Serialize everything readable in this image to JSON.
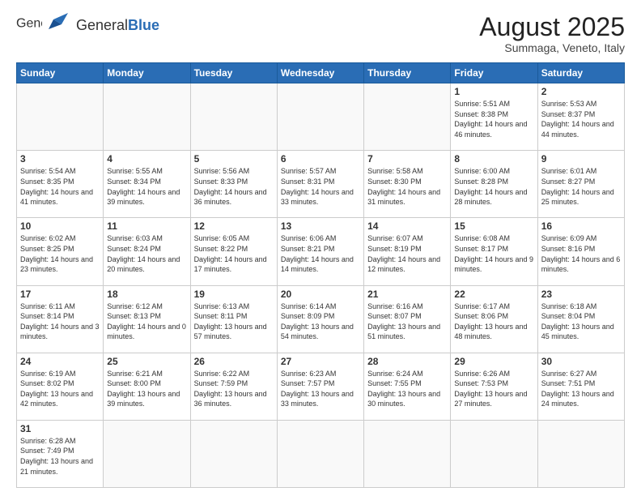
{
  "header": {
    "logo_general": "General",
    "logo_blue": "Blue",
    "month_title": "August 2025",
    "subtitle": "Summaga, Veneto, Italy"
  },
  "days_of_week": [
    "Sunday",
    "Monday",
    "Tuesday",
    "Wednesday",
    "Thursday",
    "Friday",
    "Saturday"
  ],
  "weeks": [
    [
      {
        "num": "",
        "info": ""
      },
      {
        "num": "",
        "info": ""
      },
      {
        "num": "",
        "info": ""
      },
      {
        "num": "",
        "info": ""
      },
      {
        "num": "",
        "info": ""
      },
      {
        "num": "1",
        "info": "Sunrise: 5:51 AM\nSunset: 8:38 PM\nDaylight: 14 hours and 46 minutes."
      },
      {
        "num": "2",
        "info": "Sunrise: 5:53 AM\nSunset: 8:37 PM\nDaylight: 14 hours and 44 minutes."
      }
    ],
    [
      {
        "num": "3",
        "info": "Sunrise: 5:54 AM\nSunset: 8:35 PM\nDaylight: 14 hours and 41 minutes."
      },
      {
        "num": "4",
        "info": "Sunrise: 5:55 AM\nSunset: 8:34 PM\nDaylight: 14 hours and 39 minutes."
      },
      {
        "num": "5",
        "info": "Sunrise: 5:56 AM\nSunset: 8:33 PM\nDaylight: 14 hours and 36 minutes."
      },
      {
        "num": "6",
        "info": "Sunrise: 5:57 AM\nSunset: 8:31 PM\nDaylight: 14 hours and 33 minutes."
      },
      {
        "num": "7",
        "info": "Sunrise: 5:58 AM\nSunset: 8:30 PM\nDaylight: 14 hours and 31 minutes."
      },
      {
        "num": "8",
        "info": "Sunrise: 6:00 AM\nSunset: 8:28 PM\nDaylight: 14 hours and 28 minutes."
      },
      {
        "num": "9",
        "info": "Sunrise: 6:01 AM\nSunset: 8:27 PM\nDaylight: 14 hours and 25 minutes."
      }
    ],
    [
      {
        "num": "10",
        "info": "Sunrise: 6:02 AM\nSunset: 8:25 PM\nDaylight: 14 hours and 23 minutes."
      },
      {
        "num": "11",
        "info": "Sunrise: 6:03 AM\nSunset: 8:24 PM\nDaylight: 14 hours and 20 minutes."
      },
      {
        "num": "12",
        "info": "Sunrise: 6:05 AM\nSunset: 8:22 PM\nDaylight: 14 hours and 17 minutes."
      },
      {
        "num": "13",
        "info": "Sunrise: 6:06 AM\nSunset: 8:21 PM\nDaylight: 14 hours and 14 minutes."
      },
      {
        "num": "14",
        "info": "Sunrise: 6:07 AM\nSunset: 8:19 PM\nDaylight: 14 hours and 12 minutes."
      },
      {
        "num": "15",
        "info": "Sunrise: 6:08 AM\nSunset: 8:17 PM\nDaylight: 14 hours and 9 minutes."
      },
      {
        "num": "16",
        "info": "Sunrise: 6:09 AM\nSunset: 8:16 PM\nDaylight: 14 hours and 6 minutes."
      }
    ],
    [
      {
        "num": "17",
        "info": "Sunrise: 6:11 AM\nSunset: 8:14 PM\nDaylight: 14 hours and 3 minutes."
      },
      {
        "num": "18",
        "info": "Sunrise: 6:12 AM\nSunset: 8:13 PM\nDaylight: 14 hours and 0 minutes."
      },
      {
        "num": "19",
        "info": "Sunrise: 6:13 AM\nSunset: 8:11 PM\nDaylight: 13 hours and 57 minutes."
      },
      {
        "num": "20",
        "info": "Sunrise: 6:14 AM\nSunset: 8:09 PM\nDaylight: 13 hours and 54 minutes."
      },
      {
        "num": "21",
        "info": "Sunrise: 6:16 AM\nSunset: 8:07 PM\nDaylight: 13 hours and 51 minutes."
      },
      {
        "num": "22",
        "info": "Sunrise: 6:17 AM\nSunset: 8:06 PM\nDaylight: 13 hours and 48 minutes."
      },
      {
        "num": "23",
        "info": "Sunrise: 6:18 AM\nSunset: 8:04 PM\nDaylight: 13 hours and 45 minutes."
      }
    ],
    [
      {
        "num": "24",
        "info": "Sunrise: 6:19 AM\nSunset: 8:02 PM\nDaylight: 13 hours and 42 minutes."
      },
      {
        "num": "25",
        "info": "Sunrise: 6:21 AM\nSunset: 8:00 PM\nDaylight: 13 hours and 39 minutes."
      },
      {
        "num": "26",
        "info": "Sunrise: 6:22 AM\nSunset: 7:59 PM\nDaylight: 13 hours and 36 minutes."
      },
      {
        "num": "27",
        "info": "Sunrise: 6:23 AM\nSunset: 7:57 PM\nDaylight: 13 hours and 33 minutes."
      },
      {
        "num": "28",
        "info": "Sunrise: 6:24 AM\nSunset: 7:55 PM\nDaylight: 13 hours and 30 minutes."
      },
      {
        "num": "29",
        "info": "Sunrise: 6:26 AM\nSunset: 7:53 PM\nDaylight: 13 hours and 27 minutes."
      },
      {
        "num": "30",
        "info": "Sunrise: 6:27 AM\nSunset: 7:51 PM\nDaylight: 13 hours and 24 minutes."
      }
    ],
    [
      {
        "num": "31",
        "info": "Sunrise: 6:28 AM\nSunset: 7:49 PM\nDaylight: 13 hours and 21 minutes."
      },
      {
        "num": "",
        "info": ""
      },
      {
        "num": "",
        "info": ""
      },
      {
        "num": "",
        "info": ""
      },
      {
        "num": "",
        "info": ""
      },
      {
        "num": "",
        "info": ""
      },
      {
        "num": "",
        "info": ""
      }
    ]
  ]
}
